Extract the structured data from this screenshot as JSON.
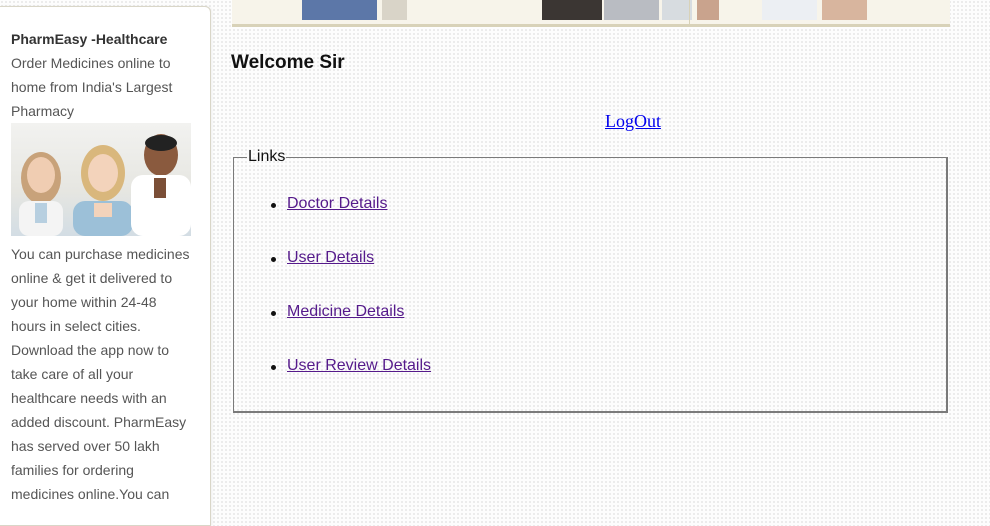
{
  "sidebar": {
    "title": "PharmEasy -Healthcare",
    "tagline": "Order Medicines online to home from India's Largest Pharmacy",
    "image_alt": "doctors-photo",
    "description": "You can purchase medicines online & get it delivered to your home within 24-48 hours in select cities. Download the app now to take care of all your healthcare needs with an added discount. PharmEasy has served over 50 lakh families for ordering medicines online.You can"
  },
  "main": {
    "welcome": "Welcome Sir",
    "logout": "LogOut",
    "links_legend": "Links",
    "links": [
      {
        "label": "Doctor Details"
      },
      {
        "label": "User Details"
      },
      {
        "label": "Medicine Details"
      },
      {
        "label": "User Review Details"
      }
    ]
  },
  "colors": {
    "link": "#551a8b",
    "logout_link": "#0000ee"
  }
}
